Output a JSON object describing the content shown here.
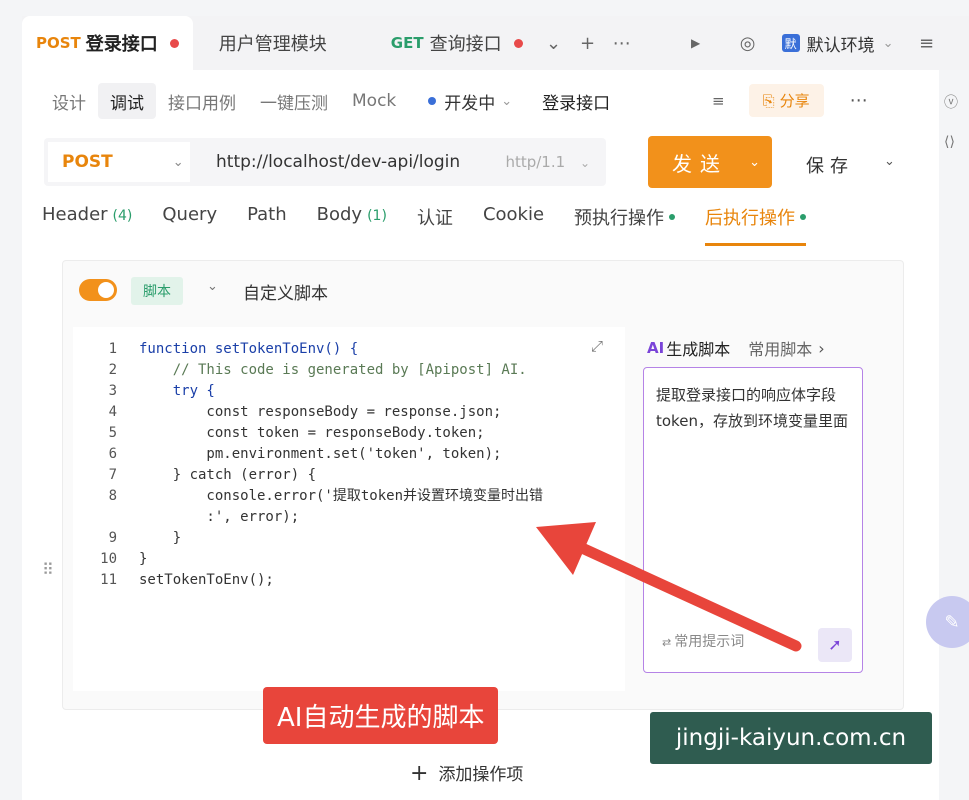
{
  "tabs": [
    {
      "method": "POST",
      "label": "登录接口",
      "active": true,
      "unsaved": true
    },
    {
      "method": "",
      "label": "用户管理模块",
      "active": false,
      "unsaved": false
    },
    {
      "method": "GET",
      "label": "查询接口",
      "active": false,
      "unsaved": true
    }
  ],
  "env": {
    "badge": "默",
    "name": "默认环境"
  },
  "subnav": {
    "items": [
      "设计",
      "调试",
      "接口用例",
      "一键压测",
      "Mock"
    ],
    "status": "开发中",
    "api_name": "登录接口",
    "share_label": "分享"
  },
  "request": {
    "method": "POST",
    "url": "http://localhost/dev-api/login",
    "protocol": "http/1.1",
    "send_label": "发送",
    "save_label": "保存"
  },
  "param_tabs": [
    {
      "label": "Header",
      "count": "(4)",
      "dot": false,
      "active": false
    },
    {
      "label": "Query",
      "count": "",
      "dot": false,
      "active": false
    },
    {
      "label": "Path",
      "count": "",
      "dot": false,
      "active": false
    },
    {
      "label": "Body",
      "count": "(1)",
      "dot": false,
      "active": false
    },
    {
      "label": "认证",
      "count": "",
      "dot": false,
      "active": false
    },
    {
      "label": "Cookie",
      "count": "",
      "dot": false,
      "active": false
    },
    {
      "label": "预执行操作",
      "count": "",
      "dot": true,
      "active": false
    },
    {
      "label": "后执行操作",
      "count": "",
      "dot": true,
      "active": true
    }
  ],
  "script": {
    "tag": "脚本",
    "name": "自定义脚本",
    "lines": [
      {
        "n": "1",
        "text": "function setTokenToEnv() {"
      },
      {
        "n": "2",
        "text": "    // This code is generated by [Apipost] AI."
      },
      {
        "n": "3",
        "text": "    try {"
      },
      {
        "n": "4",
        "text": "        const responseBody = response.json;"
      },
      {
        "n": "5",
        "text": "        const token = responseBody.token;"
      },
      {
        "n": "6",
        "text": "        pm.environment.set('token', token);"
      },
      {
        "n": "7",
        "text": "    } catch (error) {"
      },
      {
        "n": "8",
        "text": "        console.error('提取token并设置环境变量时出错"
      },
      {
        "n": "",
        "text": "        :', error);"
      },
      {
        "n": "9",
        "text": "    }"
      },
      {
        "n": "10",
        "text": "}"
      },
      {
        "n": "11",
        "text": "setTokenToEnv();"
      }
    ],
    "annotation": "AI自动生成的脚本"
  },
  "ai_panel": {
    "mark": "AI",
    "tab_active": "生成脚本",
    "tab_other": "常用脚本",
    "prompt": "提取登录接口的响应体字段token，存放到环境变量里面",
    "hint": "常用提示词"
  },
  "add_op_label": "添加操作项",
  "watermark": "jingji-kaiyun.com.cn",
  "colors": {
    "accent": "#f2911b",
    "post": "#e8850c",
    "get": "#2a9d6b",
    "annotation": "#e8453b",
    "ai": "#7a44d8"
  }
}
